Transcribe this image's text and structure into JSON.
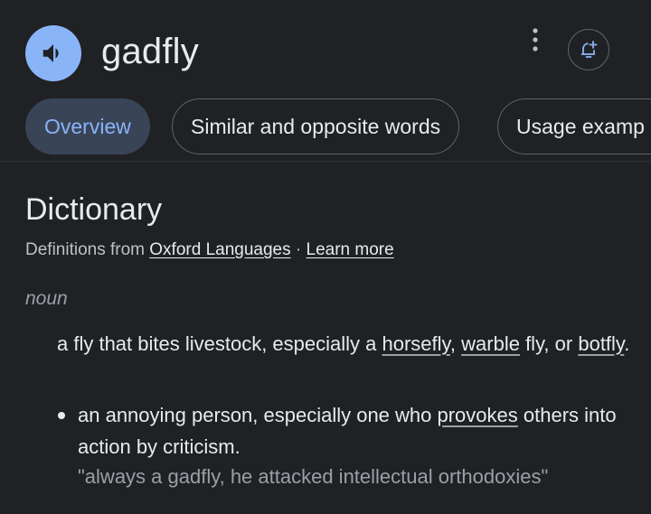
{
  "header": {
    "speaker_icon": "volume-up-icon",
    "word": "gadfly",
    "more_icon": "more-vert-icon",
    "alert_icon": "bell-plus-icon"
  },
  "tabs": [
    {
      "label": "Overview",
      "active": true
    },
    {
      "label": "Similar and opposite words",
      "active": false
    },
    {
      "label": "Usage examp",
      "active": false
    }
  ],
  "dictionary": {
    "title": "Dictionary",
    "source_prefix": "Definitions from ",
    "source_link": "Oxford Languages",
    "separator": " · ",
    "learn_more": "Learn more",
    "part_of_speech": "noun",
    "definition_1": {
      "text_a": "a fly that bites livestock, especially a ",
      "link_a": "horsefly",
      "text_b": ", ",
      "link_b": "warble",
      "text_c": " fly, or ",
      "link_c": "botfly",
      "text_d": "."
    },
    "definition_2": {
      "text_a": "an annoying person, especially one who ",
      "link_a": "provokes",
      "text_b": " others into action by criticism."
    },
    "example": "\"always a gadfly, he attacked intellectual orthodoxies\""
  },
  "colors": {
    "background": "#202124",
    "accent": "#8ab4f8",
    "active_tab_bg": "#394457",
    "text_primary": "#e8eaed",
    "text_secondary": "#9aa0a6"
  }
}
